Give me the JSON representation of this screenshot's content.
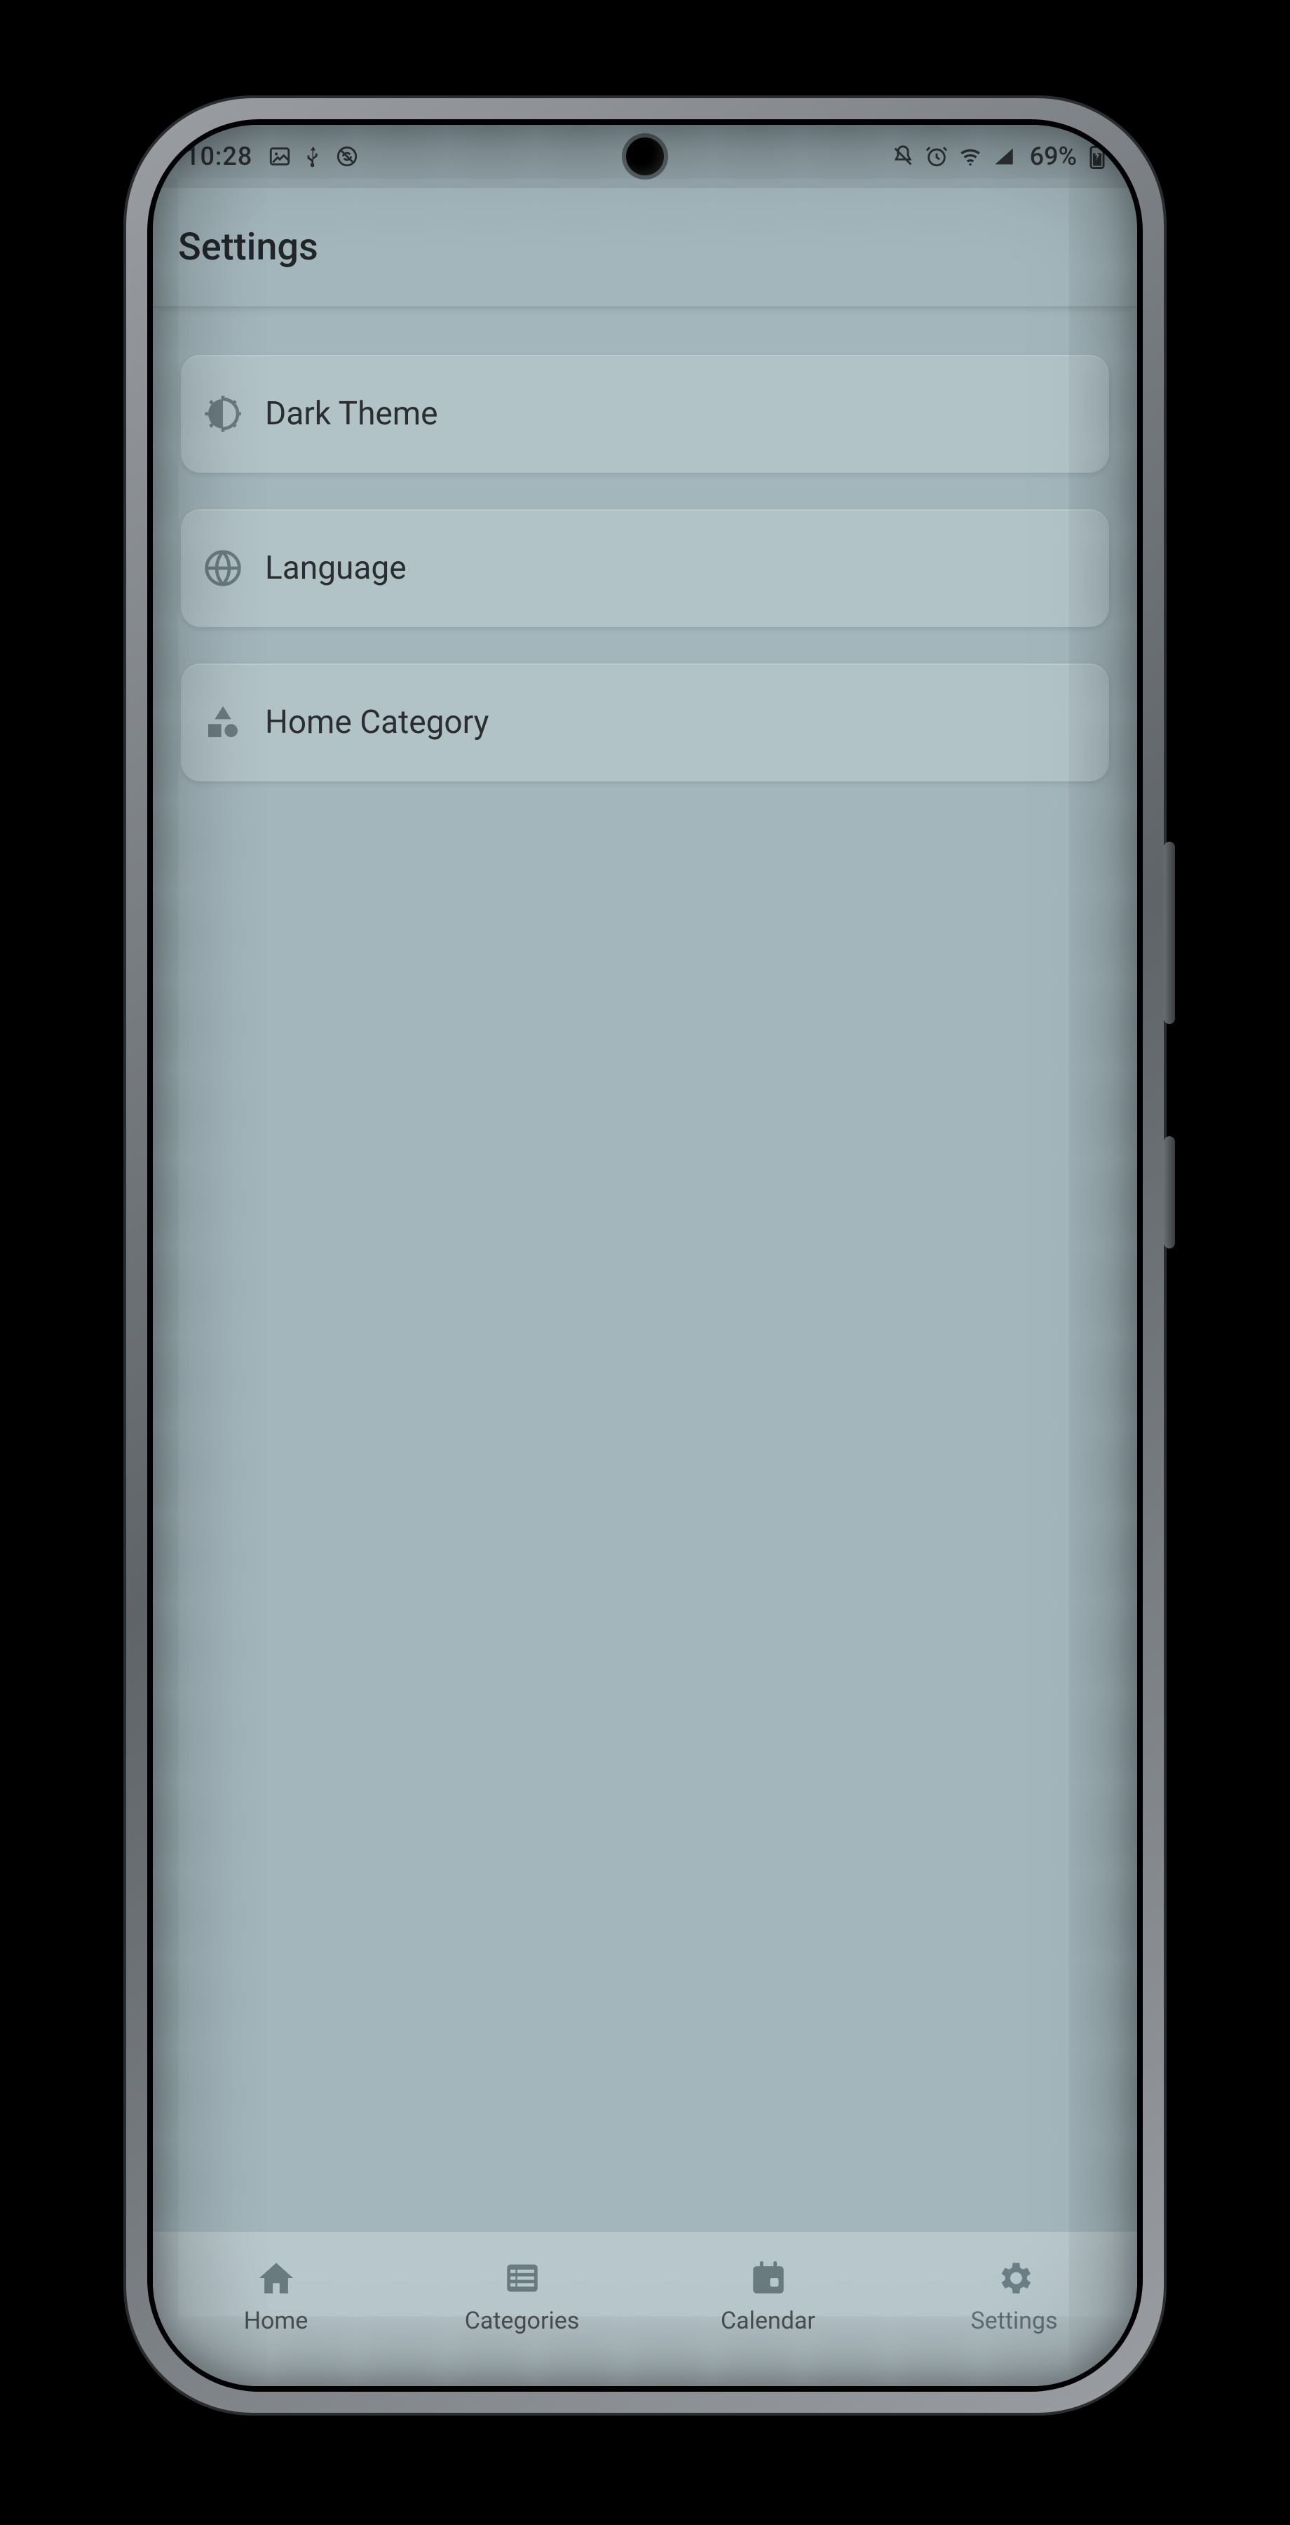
{
  "status_bar": {
    "time": "10:28",
    "battery_pct": "69%"
  },
  "app_bar": {
    "title": "Settings"
  },
  "settings": {
    "items": [
      {
        "label": "Dark Theme"
      },
      {
        "label": "Language"
      },
      {
        "label": "Home Category"
      }
    ]
  },
  "bottom_nav": {
    "items": [
      {
        "label": "Home"
      },
      {
        "label": "Categories"
      },
      {
        "label": "Calendar"
      },
      {
        "label": "Settings"
      }
    ],
    "active_index": 3
  }
}
